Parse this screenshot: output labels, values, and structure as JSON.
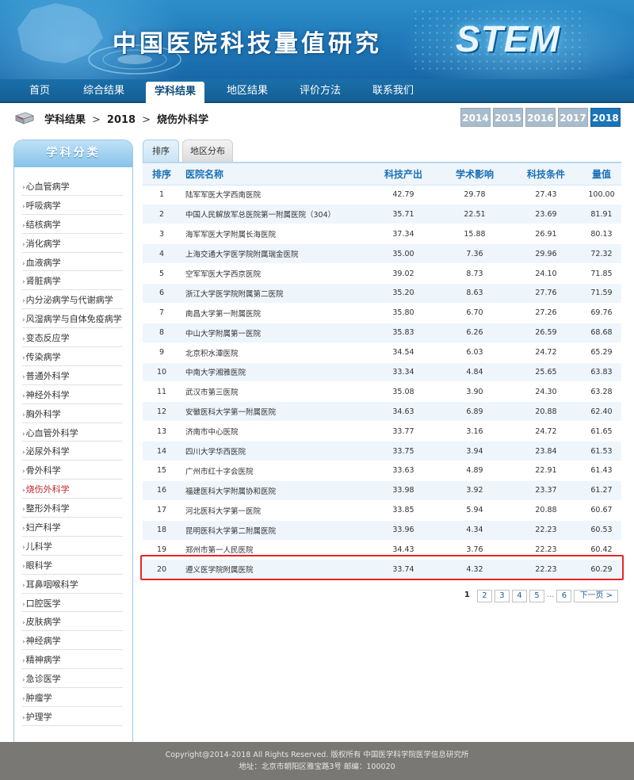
{
  "header": {
    "site_title": "中国医院科技量值研究",
    "logo_text": "STEM"
  },
  "nav": {
    "items": [
      {
        "label": "首页"
      },
      {
        "label": "综合结果"
      },
      {
        "label": "学科结果"
      },
      {
        "label": "地区结果"
      },
      {
        "label": "评价方法"
      },
      {
        "label": "联系我们"
      }
    ],
    "active": "学科结果"
  },
  "breadcrumb": {
    "items": [
      "学科结果",
      "2018",
      "烧伤外科学"
    ],
    "separator": ">"
  },
  "years": [
    "2014",
    "2015",
    "2016",
    "2017",
    "2018"
  ],
  "active_year": "2018",
  "sidebar": {
    "title": "学科分类",
    "active": "烧伤外科学",
    "categories": [
      "心血管病学",
      "呼吸病学",
      "结核病学",
      "消化病学",
      "血液病学",
      "肾脏病学",
      "内分泌病学与代谢病学",
      "风湿病学与自体免疫病学",
      "变态反应学",
      "传染病学",
      "普通外科学",
      "神经外科学",
      "胸外科学",
      "心血管外科学",
      "泌尿外科学",
      "骨外科学",
      "烧伤外科学",
      "整形外科学",
      "妇产科学",
      "儿科学",
      "眼科学",
      "耳鼻咽喉科学",
      "口腔医学",
      "皮肤病学",
      "神经病学",
      "精神病学",
      "急诊医学",
      "肿瘤学",
      "护理学"
    ]
  },
  "panel_tabs": [
    {
      "label": "排序"
    },
    {
      "label": "地区分布"
    }
  ],
  "table": {
    "headers": [
      "排序",
      "医院名称",
      "科技产出",
      "学术影响",
      "科技条件",
      "量值"
    ],
    "rows": [
      [
        "1",
        "陆军军医大学西南医院",
        "42.79",
        "29.78",
        "27.43",
        "100.00"
      ],
      [
        "2",
        "中国人民解放军总医院第一附属医院（304）",
        "35.71",
        "22.51",
        "23.69",
        "81.91"
      ],
      [
        "3",
        "海军军医大学附属长海医院",
        "37.34",
        "15.88",
        "26.91",
        "80.13"
      ],
      [
        "4",
        "上海交通大学医学院附属瑞金医院",
        "35.00",
        "7.36",
        "29.96",
        "72.32"
      ],
      [
        "5",
        "空军军医大学西京医院",
        "39.02",
        "8.73",
        "24.10",
        "71.85"
      ],
      [
        "6",
        "浙江大学医学院附属第二医院",
        "35.20",
        "8.63",
        "27.76",
        "71.59"
      ],
      [
        "7",
        "南昌大学第一附属医院",
        "35.80",
        "6.70",
        "27.26",
        "69.76"
      ],
      [
        "8",
        "中山大学附属第一医院",
        "35.83",
        "6.26",
        "26.59",
        "68.68"
      ],
      [
        "9",
        "北京积水潭医院",
        "34.54",
        "6.03",
        "24.72",
        "65.29"
      ],
      [
        "10",
        "中南大学湘雅医院",
        "33.34",
        "4.84",
        "25.65",
        "63.83"
      ],
      [
        "11",
        "武汉市第三医院",
        "35.08",
        "3.90",
        "24.30",
        "63.28"
      ],
      [
        "12",
        "安徽医科大学第一附属医院",
        "34.63",
        "6.89",
        "20.88",
        "62.40"
      ],
      [
        "13",
        "济南市中心医院",
        "33.77",
        "3.16",
        "24.72",
        "61.65"
      ],
      [
        "14",
        "四川大学华西医院",
        "33.75",
        "3.94",
        "23.84",
        "61.53"
      ],
      [
        "15",
        "广州市红十字会医院",
        "33.63",
        "4.89",
        "22.91",
        "61.43"
      ],
      [
        "16",
        "福建医科大学附属协和医院",
        "33.98",
        "3.92",
        "23.37",
        "61.27"
      ],
      [
        "17",
        "河北医科大学第一医院",
        "33.85",
        "5.94",
        "20.88",
        "60.67"
      ],
      [
        "18",
        "昆明医科大学第二附属医院",
        "33.96",
        "4.34",
        "22.23",
        "60.53"
      ],
      [
        "19",
        "郑州市第一人民医院",
        "34.43",
        "3.76",
        "22.23",
        "60.42"
      ],
      [
        "20",
        "遵义医学院附属医院",
        "33.74",
        "4.32",
        "22.23",
        "60.29"
      ]
    ]
  },
  "pagination": {
    "current": "1",
    "pages": [
      "2",
      "3",
      "4",
      "5"
    ],
    "ellipsis": "...",
    "last": "6",
    "next_label": "下一页 >"
  },
  "footer": {
    "copyright": "Copyright@2014-2018 All Rights Reserved. 版权所有 中国医学科学院医学信息研究所",
    "address": "地址：北京市朝阳区雅宝路3号 邮编：100020"
  },
  "colors": {
    "brand_blue": "#1b74b8",
    "highlight_red": "#e8232a",
    "active_category": "#c0272d"
  }
}
